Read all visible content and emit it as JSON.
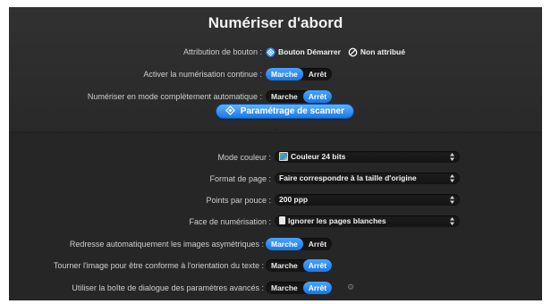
{
  "title": "Numériser d'abord",
  "button_assignment": {
    "label": "Attribution de bouton :",
    "options": [
      "Bouton Démarrer",
      "Non attribué"
    ],
    "selected": "Bouton Démarrer"
  },
  "continuous_scan": {
    "label": "Activer la numérisation continue :",
    "options": [
      "Marche",
      "Arrêt"
    ],
    "selected": "Marche"
  },
  "full_auto": {
    "label": "Numériser en mode complètement automatique :",
    "options": [
      "Marche",
      "Arrêt"
    ],
    "selected": "Arrêt"
  },
  "scanner_settings_button": "Paramétrage de scanner",
  "color_mode": {
    "label": "Mode couleur :",
    "value": "Couleur 24 bits",
    "icon": "color-image-icon"
  },
  "page_format": {
    "label": "Format de page :",
    "value": "Faire correspondre à la taille d'origine"
  },
  "dpi": {
    "label": "Points par pouce :",
    "value": "200 ppp"
  },
  "scan_side": {
    "label": "Face de numérisation :",
    "value": "Ignorer les pages blanches",
    "icon": "page-icon"
  },
  "deskew": {
    "label": "Redresse automatiquement les images asymétriques :",
    "options": [
      "Marche",
      "Arrêt"
    ],
    "selected": "Marche"
  },
  "rotate": {
    "label": "Tourner l'image pour être conforme à l'orientation du texte :",
    "options": [
      "Marche",
      "Arrêt"
    ],
    "selected": "Arrêt"
  },
  "advanced_dialog": {
    "label": "Utiliser la boîte de dialogue des paramètres avancés :",
    "options": [
      "Marche",
      "Arrêt"
    ],
    "selected": "Arrêt"
  },
  "colors": {
    "accent": "#1f80f0",
    "panel_top": "#313132",
    "panel_bottom": "#262627"
  }
}
